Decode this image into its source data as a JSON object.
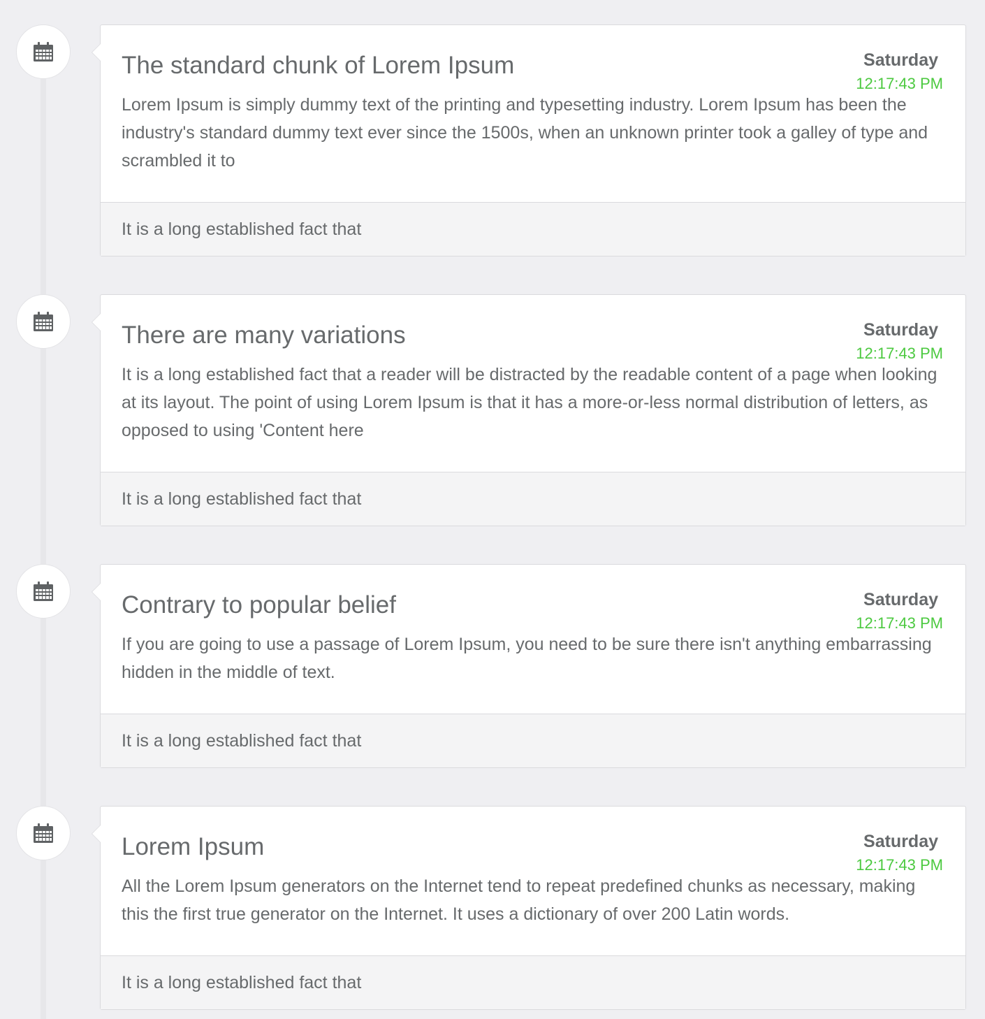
{
  "timeline": {
    "items": [
      {
        "title": "The standard chunk of Lorem Ipsum",
        "day": "Saturday",
        "time": "12:17:43 PM",
        "text": "Lorem Ipsum is simply dummy text of the printing and typesetting industry. Lorem Ipsum has been the industry's standard dummy text ever since the 1500s, when an unknown printer took a galley of type and scrambled it to",
        "footer": "It is a long established fact that",
        "icon": "calendar-icon"
      },
      {
        "title": "There are many variations",
        "day": "Saturday",
        "time": "12:17:43 PM",
        "text": "It is a long established fact that a reader will be distracted by the readable content of a page when looking at its layout. The point of using Lorem Ipsum is that it has a more-or-less normal distribution of letters, as opposed to using 'Content here",
        "footer": "It is a long established fact that",
        "icon": "calendar-icon"
      },
      {
        "title": "Contrary to popular belief",
        "day": "Saturday",
        "time": "12:17:43 PM",
        "text": "If you are going to use a passage of Lorem Ipsum, you need to be sure there isn't anything embarrassing hidden in the middle of text.",
        "footer": "It is a long established fact that",
        "icon": "calendar-icon"
      },
      {
        "title": "Lorem Ipsum",
        "day": "Saturday",
        "time": "12:17:43 PM",
        "text": "All the Lorem Ipsum generators on the Internet tend to repeat predefined chunks as necessary, making this the first true generator on the Internet. It uses a dictionary of over 200 Latin words.",
        "footer": "It is a long established fact that",
        "icon": "calendar-icon"
      }
    ]
  },
  "colors": {
    "background": "#efeff2",
    "time_accent": "#4cc940",
    "text": "#676a6c",
    "footer_bg": "#f4f4f5"
  }
}
